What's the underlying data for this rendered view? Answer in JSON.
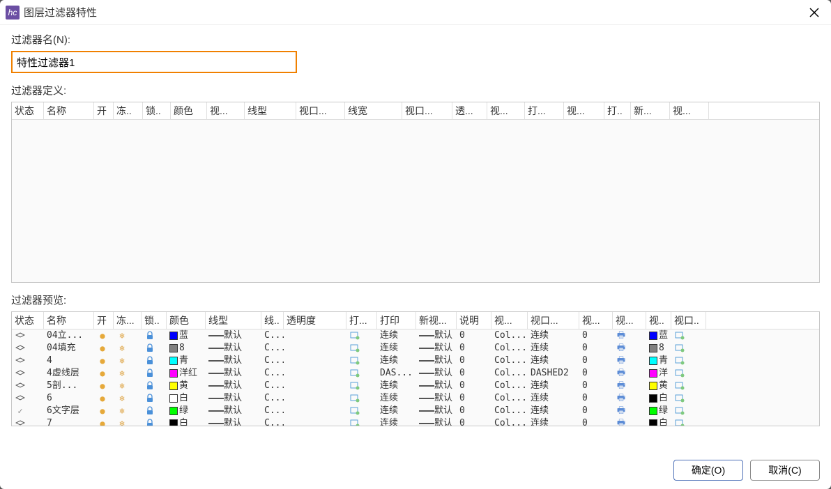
{
  "app_icon_text": "hc",
  "window_title": "图层过滤器特性",
  "filter_name_label": "过滤器名(N):",
  "filter_name_value": "特性过滤器1",
  "filter_def_label": "过滤器定义:",
  "filter_preview_label": "过滤器预览:",
  "def_headers": [
    "状态",
    "名称",
    "开",
    "冻..",
    "锁..",
    "颜色",
    "视...",
    "线型",
    "视口...",
    "线宽",
    "视口...",
    "透...",
    "视...",
    "打...",
    "视...",
    "打..",
    "新...",
    "视..."
  ],
  "def_widths": [
    46,
    72,
    28,
    42,
    40,
    52,
    54,
    74,
    70,
    82,
    72,
    50,
    54,
    56,
    58,
    38,
    56,
    56
  ],
  "preview_headers": [
    "状态",
    "名称",
    "开",
    "冻...",
    "锁..",
    "颜色",
    "线型",
    "线..",
    "透明度",
    "打...",
    "打印",
    "新视...",
    "说明",
    "视...",
    "视口...",
    "视...",
    "视...",
    "视..",
    "视口.."
  ],
  "preview_widths": [
    46,
    72,
    28,
    40,
    36,
    56,
    80,
    32,
    90,
    44,
    56,
    58,
    50,
    52,
    74,
    48,
    48,
    36,
    50
  ],
  "rows": [
    {
      "status": "layer",
      "name": "04立...",
      "color": "#0000ff",
      "color_label": "蓝",
      "lt": "默认",
      "lt2": "C...",
      "lw": "连续",
      "lw2": "默认",
      "tr": "0",
      "pl": "Col...",
      "vp1": "连续",
      "vp2": "0",
      "c2": "#0000ff",
      "c2l": "蓝"
    },
    {
      "status": "layer",
      "name": "04填充",
      "color": "#808080",
      "color_label": "8",
      "lt": "默认",
      "lt2": "C...",
      "lw": "连续",
      "lw2": "默认",
      "tr": "0",
      "pl": "Col...",
      "vp1": "连续",
      "vp2": "0",
      "c2": "#808080",
      "c2l": "8"
    },
    {
      "status": "layer",
      "name": "4",
      "color": "#00ffff",
      "color_label": "青",
      "lt": "默认",
      "lt2": "C...",
      "lw": "连续",
      "lw2": "默认",
      "tr": "0",
      "pl": "Col...",
      "vp1": "连续",
      "vp2": "0",
      "c2": "#00ffff",
      "c2l": "青"
    },
    {
      "status": "layer",
      "name": "4虚线层",
      "color": "#ff00ff",
      "color_label": "洋红",
      "lt": "默认",
      "lt2": "C...",
      "lw": "DAS...",
      "lw2": "默认",
      "tr": "0",
      "pl": "Col...",
      "vp1": "DASHED2",
      "vp2": "0",
      "c2": "#ff00ff",
      "c2l": "洋"
    },
    {
      "status": "layer",
      "name": "5剖...",
      "color": "#ffff00",
      "color_label": "黄",
      "lt": "默认",
      "lt2": "C...",
      "lw": "连续",
      "lw2": "默认",
      "tr": "0",
      "pl": "Col...",
      "vp1": "连续",
      "vp2": "0",
      "c2": "#ffff00",
      "c2l": "黄"
    },
    {
      "status": "layer",
      "name": "6",
      "color": "#ffffff",
      "color_label": "白",
      "lt": "默认",
      "lt2": "C...",
      "lw": "连续",
      "lw2": "默认",
      "tr": "0",
      "pl": "Col...",
      "vp1": "连续",
      "vp2": "0",
      "c2": "#000000",
      "c2l": "白"
    },
    {
      "status": "check",
      "name": "6文字层",
      "color": "#00ff00",
      "color_label": "绿",
      "lt": "默认",
      "lt2": "C...",
      "lw": "连续",
      "lw2": "默认",
      "tr": "0",
      "pl": "Col...",
      "vp1": "连续",
      "vp2": "0",
      "c2": "#00ff00",
      "c2l": "绿"
    },
    {
      "status": "layer",
      "name": "7",
      "color": "#000000",
      "color_label": "白",
      "lt": "默认",
      "lt2": "C...",
      "lw": "连续",
      "lw2": "默认",
      "tr": "0",
      "pl": "Col...",
      "vp1": "连续",
      "vp2": "0",
      "c2": "#000000",
      "c2l": "白"
    }
  ],
  "ok_label": "确定(O)",
  "cancel_label": "取消(C)"
}
